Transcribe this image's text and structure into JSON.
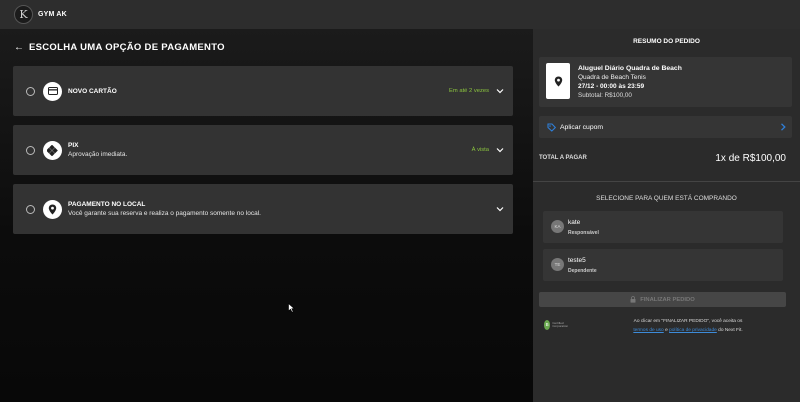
{
  "header": {
    "brand": "GYM AK",
    "logo_letter": "K"
  },
  "main": {
    "title": "ESCOLHA UMA OPÇÃO DE PAGAMENTO",
    "options": [
      {
        "name": "NOVO CARTÃO",
        "desc": "",
        "note": "Em até 2 vezes",
        "icon": "credit-card-icon"
      },
      {
        "name": "PIX",
        "desc": "Aprovação imediata.",
        "note": "À vista",
        "icon": "pix-icon"
      },
      {
        "name": "PAGAMENTO NO LOCAL",
        "desc": "Você garante sua reserva e realiza o pagamento somente no local.",
        "note": "",
        "icon": "location-pin-icon"
      }
    ]
  },
  "summary": {
    "title": "RESUMO DO PEDIDO",
    "item": {
      "name": "Aluguel Diário Quadra de Beach",
      "court": "Quadra de Beach Tenis",
      "time": "27/12 - 00:00 às 23:59",
      "subtotal": "Subtotal: R$100,00"
    },
    "coupon_label": "Aplicar cupom",
    "total_label": "TOTAL A PAGAR",
    "total_value": "1x de R$100,00",
    "select_title": "SELECIONE PARA QUEM ESTÁ COMPRANDO",
    "people": [
      {
        "initials": "KA",
        "name": "kate",
        "role": "Responsável"
      },
      {
        "initials": "TE",
        "name": "teste5",
        "role": "Dependente"
      }
    ],
    "finalize_label": "FINALIZAR PEDIDO",
    "terms": {
      "prefix": "Ao clicar em \"FINALIZAR PEDIDO\", você aceita os",
      "link1": "termos de uso",
      "and": " e ",
      "link2": "política de privacidade",
      "suffix": " do Next Fit."
    },
    "badge": {
      "mark": "B",
      "text": "Certified Corporation"
    }
  },
  "colors": {
    "accent_green": "#8cc63f",
    "link_blue": "#3d8bd9",
    "coupon_blue": "#2f7fd8"
  }
}
